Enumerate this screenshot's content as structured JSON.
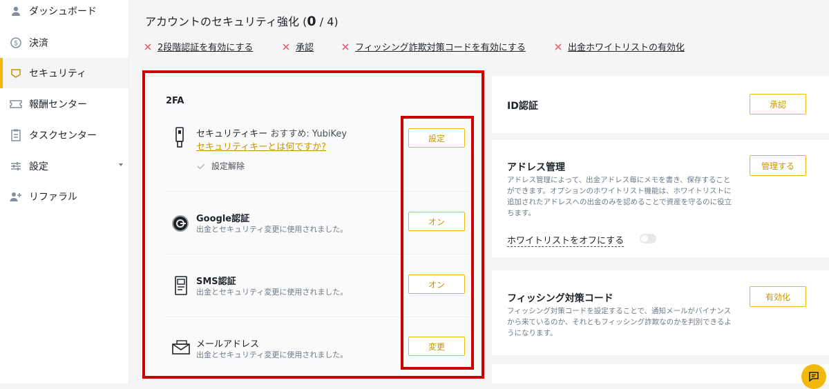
{
  "sidebar": {
    "items": [
      {
        "label": "ダッシュボード",
        "icon": "user-icon"
      },
      {
        "label": "決済",
        "icon": "dollar-circle-icon"
      },
      {
        "label": "セキュリティ",
        "icon": "shield-icon",
        "active": true
      },
      {
        "label": "報酬センター",
        "icon": "ticket-icon"
      },
      {
        "label": "タスクセンター",
        "icon": "clipboard-icon"
      },
      {
        "label": "設定",
        "icon": "sliders-icon"
      },
      {
        "label": "リファラル",
        "icon": "add-user-icon"
      }
    ]
  },
  "header": {
    "title": "アカウントのセキュリティ強化",
    "count_prefix": "(",
    "count": "0",
    "count_suffix": "/ 4)",
    "tasks": [
      "2段階認証を有効にする",
      "承認",
      "フィッシング詐欺対策コードを有効にする",
      "出金ホワイトリストの有効化"
    ]
  },
  "twofa": {
    "section_title": "2FA",
    "security_key": {
      "title": "セキュリティキー",
      "recommend": "おすすめ: YubiKey",
      "link": "セキュリティキーとは何ですか?",
      "unset": "設定解除",
      "button": "設定"
    },
    "google": {
      "title": "Google認証",
      "desc": "出金とセキュリティ変更に使用されました。",
      "button": "オン"
    },
    "sms": {
      "title": "SMS認証",
      "desc": "出金とセキュリティ変更に使用されました。",
      "button": "オン"
    },
    "email": {
      "title": "メールアドレス",
      "desc": "出金とセキュリティ変更に使用されました。",
      "button": "変更"
    }
  },
  "identity": {
    "title": "ID認証",
    "button": "承認"
  },
  "address": {
    "title": "アドレス管理",
    "desc": "アドレス管理によって、出金アドレス毎にメモを書き、保存することができます。オプションのホワイトリスト機能は、ホワイトリストに追加されたアドレスへの出金のみを認めることで資産を守るのに役立ちます。",
    "button": "管理する",
    "whitelist_label": "ホワイトリストをオフにする",
    "whitelist_on": false
  },
  "antiphishing": {
    "title": "フィッシング対策コード",
    "desc": "フィッシング対策コードを設定することで、通知メールがバイナンスから来ているのか、それともフィッシング詐欺なのかを判別できるようになります。",
    "button": "有効化"
  },
  "colors": {
    "accent": "#f0b90b",
    "accent_text": "#c99400",
    "highlight": "#cc0000",
    "error_x": "#e06677"
  }
}
